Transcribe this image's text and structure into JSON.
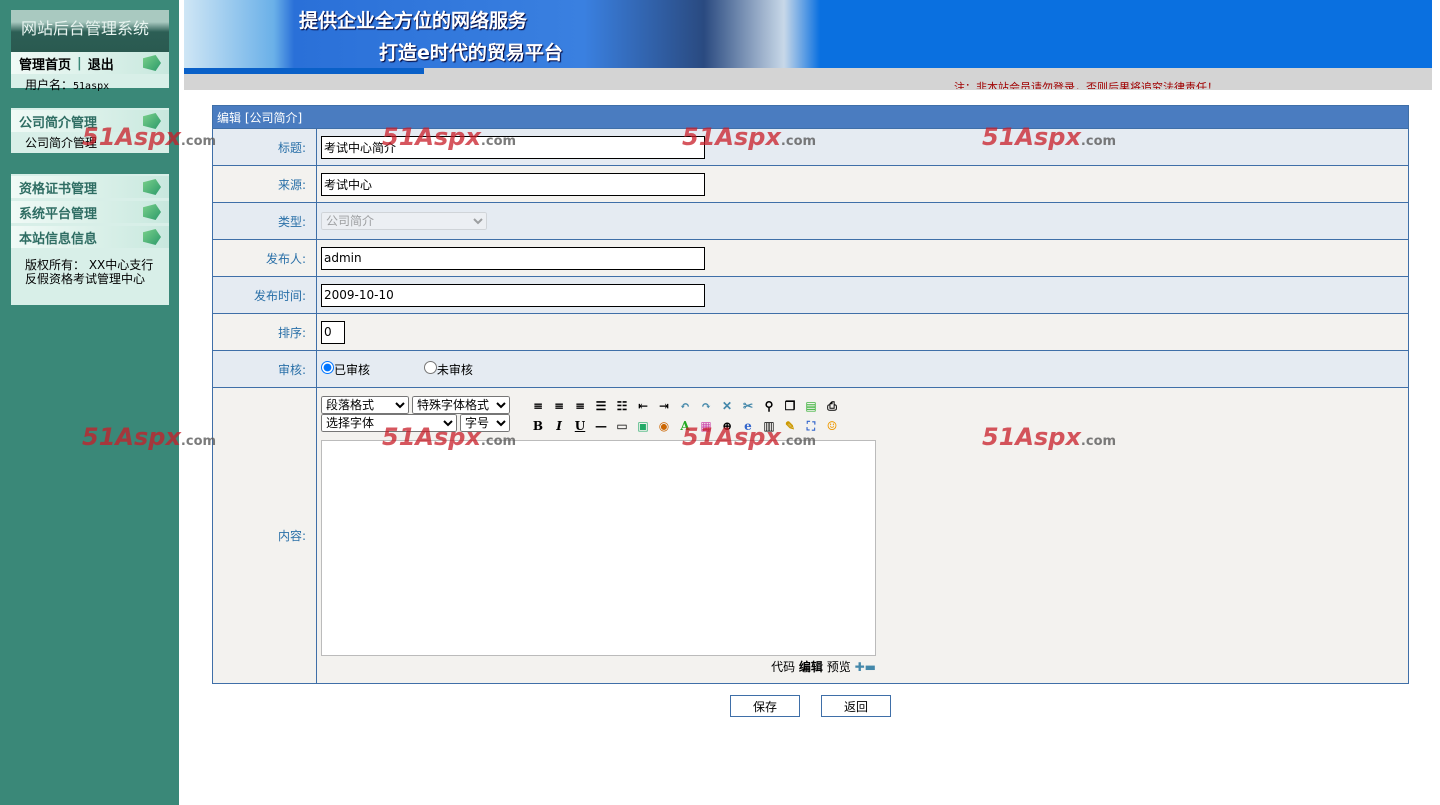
{
  "sidebar": {
    "title": "网站后台管理系统",
    "home": "管理首页",
    "sep": "|",
    "logout": "退出",
    "user_label": "用户名：",
    "user": "51aspx",
    "groups": [
      {
        "label": "公司简介管理",
        "sub": "公司简介管理"
      },
      {
        "label": "资格证书管理"
      },
      {
        "label": "系统平台管理"
      },
      {
        "label": "本站信息信息"
      }
    ],
    "copyright1": "版权所有： XX中心支行",
    "copyright2": "反假资格考试管理中心"
  },
  "banner": {
    "line1": "提供企业全方位的网络服务",
    "line2": "打造e时代的贸易平台",
    "notice": "注：非本站会员请勿登录，否则后果将追究法律责任！"
  },
  "form": {
    "header": "编辑 [公司简介]",
    "title_label": "标题:",
    "title_value": "考试中心简介",
    "source_label": "来源:",
    "source_value": "考试中心",
    "type_label": "类型:",
    "type_value": "公司简介",
    "publisher_label": "发布人:",
    "publisher_value": "admin",
    "time_label": "发布时间:",
    "time_value": "2009-10-10",
    "order_label": "排序:",
    "order_value": "0",
    "audit_label": "审核:",
    "audit_yes": "已审核",
    "audit_no": "未审核",
    "content_label": "内容:"
  },
  "editor": {
    "para": "段落格式",
    "special": "特殊字体格式",
    "font": "选择字体",
    "size": "字号",
    "bold": "B",
    "italic": "I",
    "underline": "U",
    "tab_code": "代码",
    "tab_edit": "编辑",
    "tab_preview": "预览"
  },
  "buttons": {
    "save": "保存",
    "back": "返回"
  },
  "watermark": "51Aspx",
  "watermark_suffix": ".com"
}
